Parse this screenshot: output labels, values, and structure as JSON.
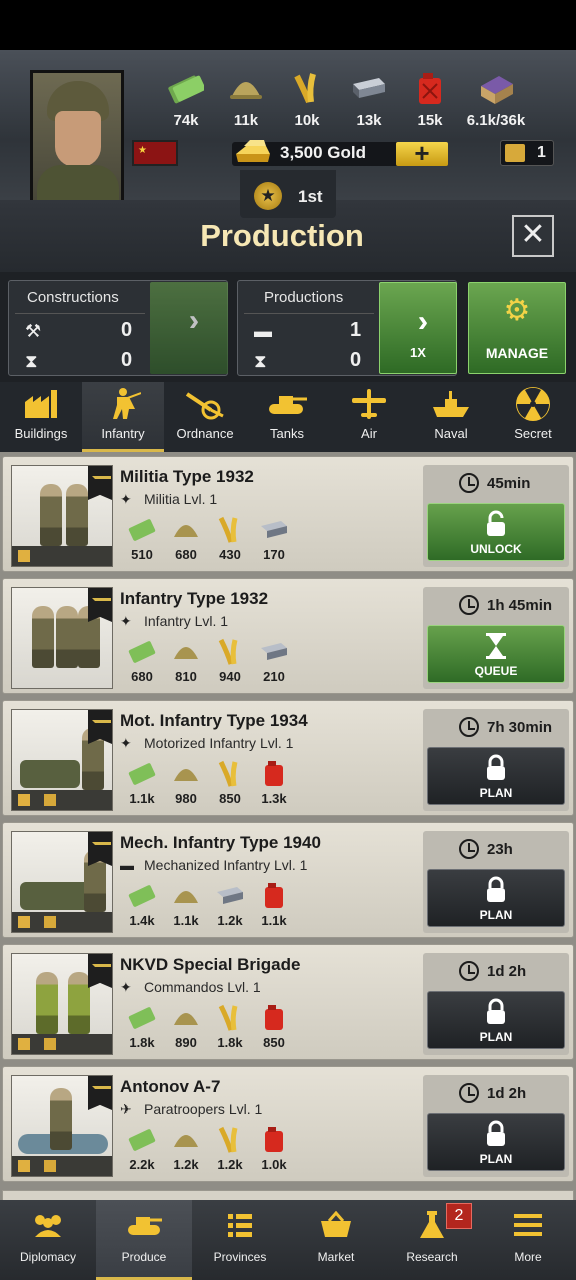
{
  "resources": [
    {
      "name": "money",
      "value": "74k"
    },
    {
      "name": "manpower",
      "value": "11k"
    },
    {
      "name": "food",
      "value": "10k"
    },
    {
      "name": "steel",
      "value": "13k"
    },
    {
      "name": "fuel",
      "value": "15k"
    },
    {
      "name": "goods",
      "value": "6.1k/36k"
    }
  ],
  "gold": {
    "label": "3,500 Gold",
    "plus": "+"
  },
  "calc_count": "1",
  "rank": "1st",
  "title": "Production",
  "close": "✕",
  "constructions": {
    "label": "Constructions",
    "active": "0",
    "queued": "0"
  },
  "productions": {
    "label": "Productions",
    "active": "1",
    "queued": "0",
    "speed": "1X"
  },
  "manage": "MANAGE",
  "tabs": [
    "Buildings",
    "Infantry",
    "Ordnance",
    "Tanks",
    "Air",
    "Naval",
    "Secret"
  ],
  "units": [
    {
      "name": "Militia Type 1932",
      "type": "Militia Lvl. 1",
      "time": "45min",
      "action": "UNLOCK",
      "costs": [
        {
          "r": "money",
          "v": "510"
        },
        {
          "r": "manpower",
          "v": "680"
        },
        {
          "r": "food",
          "v": "430"
        },
        {
          "r": "steel",
          "v": "170"
        }
      ]
    },
    {
      "name": "Infantry Type 1932",
      "type": "Infantry Lvl. 1",
      "time": "1h 45min",
      "action": "QUEUE",
      "costs": [
        {
          "r": "money",
          "v": "680"
        },
        {
          "r": "manpower",
          "v": "810"
        },
        {
          "r": "food",
          "v": "940"
        },
        {
          "r": "steel",
          "v": "210"
        }
      ]
    },
    {
      "name": "Mot. Infantry Type 1934",
      "type": "Motorized Infantry Lvl. 1",
      "time": "7h 30min",
      "action": "PLAN",
      "costs": [
        {
          "r": "money",
          "v": "1.1k"
        },
        {
          "r": "manpower",
          "v": "980"
        },
        {
          "r": "food",
          "v": "850"
        },
        {
          "r": "fuel",
          "v": "1.3k"
        }
      ]
    },
    {
      "name": "Mech. Infantry Type 1940",
      "type": "Mechanized Infantry Lvl. 1",
      "time": "23h",
      "action": "PLAN",
      "costs": [
        {
          "r": "money",
          "v": "1.4k"
        },
        {
          "r": "manpower",
          "v": "1.1k"
        },
        {
          "r": "steel",
          "v": "1.2k"
        },
        {
          "r": "fuel",
          "v": "1.1k"
        }
      ]
    },
    {
      "name": "NKVD Special Brigade",
      "type": "Commandos Lvl. 1",
      "time": "1d 2h",
      "action": "PLAN",
      "costs": [
        {
          "r": "money",
          "v": "1.8k"
        },
        {
          "r": "manpower",
          "v": "890"
        },
        {
          "r": "food",
          "v": "1.8k"
        },
        {
          "r": "fuel",
          "v": "850"
        }
      ]
    },
    {
      "name": "Antonov A-7",
      "type": "Paratroopers Lvl. 1",
      "time": "1d 2h",
      "action": "PLAN",
      "costs": [
        {
          "r": "money",
          "v": "2.2k"
        },
        {
          "r": "manpower",
          "v": "1.2k"
        },
        {
          "r": "food",
          "v": "1.2k"
        },
        {
          "r": "fuel",
          "v": "1.0k"
        }
      ]
    }
  ],
  "nav": [
    "Diplomacy",
    "Produce",
    "Provinces",
    "Market",
    "Research",
    "More"
  ],
  "research_badge": "2"
}
